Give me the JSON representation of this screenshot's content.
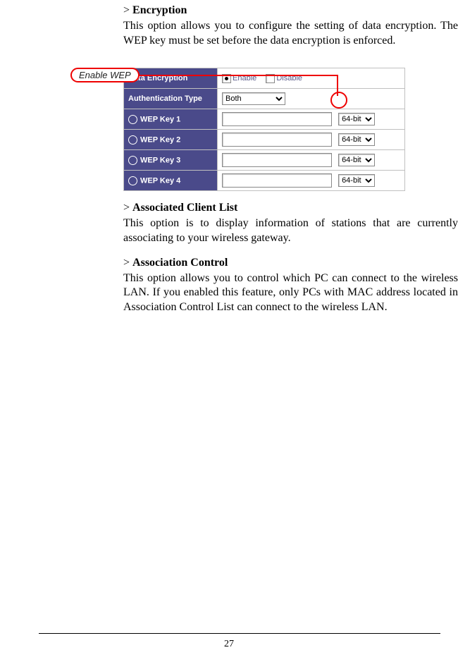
{
  "sections": {
    "encryption": {
      "marker": "> ",
      "title": "Encryption",
      "body": "This option allows you to configure the setting of data encryption.  The WEP key must be set before the data encryption is enforced."
    },
    "associatedClientList": {
      "marker": "> ",
      "title": "Associated Client List",
      "body": "This option is to display information of stations that are currently associating to your wireless gateway."
    },
    "associationControl": {
      "marker": "> ",
      "title": "Association Control",
      "body": "This option allows you to control which PC can connect to the wireless LAN.  If you enabled this feature, only PCs with MAC address located in Association Control List can connect to the wireless LAN."
    }
  },
  "callout": {
    "label": "Enable WEP"
  },
  "screenshot": {
    "rows": {
      "dataEncryption": {
        "label": "Data Encryption",
        "enable": "Enable",
        "disable": "Disable"
      },
      "authType": {
        "label": "Authentication Type",
        "value": "Both"
      },
      "wep1": {
        "label": "WEP Key 1",
        "bits": "64-bit"
      },
      "wep2": {
        "label": "WEP Key 2",
        "bits": "64-bit"
      },
      "wep3": {
        "label": "WEP Key 3",
        "bits": "64-bit"
      },
      "wep4": {
        "label": "WEP Key 4",
        "bits": "64-bit"
      }
    }
  },
  "pageNumber": "27"
}
